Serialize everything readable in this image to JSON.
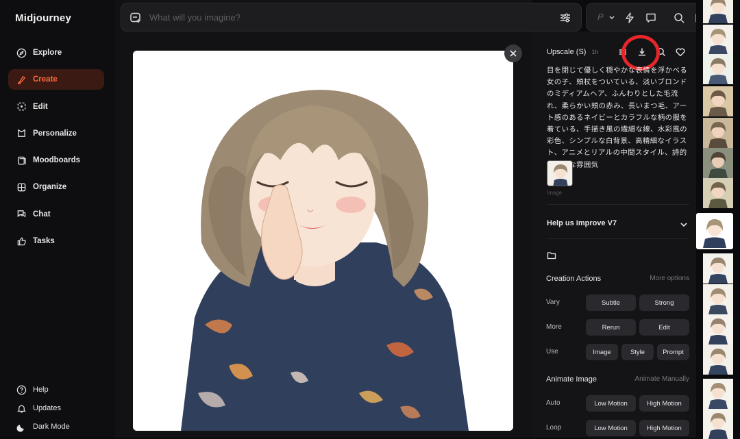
{
  "app": {
    "title": "Midjourney"
  },
  "nav": {
    "items": [
      {
        "label": "Explore",
        "icon": "compass-icon"
      },
      {
        "label": "Create",
        "icon": "brush-icon",
        "active": true
      },
      {
        "label": "Edit",
        "icon": "edit-icon"
      },
      {
        "label": "Personalize",
        "icon": "personalize-icon"
      },
      {
        "label": "Moodboards",
        "icon": "moodboard-icon"
      },
      {
        "label": "Organize",
        "icon": "grid-icon"
      },
      {
        "label": "Chat",
        "icon": "chat-icon"
      },
      {
        "label": "Tasks",
        "icon": "thumbs-up-icon"
      }
    ],
    "bottom": [
      {
        "label": "Help",
        "icon": "help-icon"
      },
      {
        "label": "Updates",
        "icon": "bell-icon"
      },
      {
        "label": "Dark Mode",
        "icon": "moon-icon"
      }
    ]
  },
  "search": {
    "placeholder": "What will you imagine?"
  },
  "toolbox": {
    "p_label": "P"
  },
  "panel": {
    "upscale_label": "Upscale (S)",
    "time_ago": "1h",
    "prompt": "目を閉じて優しく穏やかな表情を浮かべる女の子、頬杖をついている、淡いブロンドのミディアムヘア、ふんわりとした毛流れ、柔らかい頬の赤み、長いまつ毛、アート感のあるネイビーとカラフルな柄の服を着ている、手描き風の繊細な線、水彩風の彩色、シンプルな白背景、高精細なイラスト、アニメとリアルの中間スタイル、詩的で静かな雰囲気",
    "ref_caption": "Image",
    "help_title": "Help us improve V7",
    "creation": {
      "title": "Creation Actions",
      "link": "More options"
    },
    "vary": {
      "label": "Vary",
      "buttons": [
        "Subtle",
        "Strong"
      ]
    },
    "more": {
      "label": "More",
      "buttons": [
        "Rerun",
        "Edit"
      ]
    },
    "use": {
      "label": "Use",
      "buttons": [
        "Image",
        "Style",
        "Prompt"
      ]
    },
    "animate": {
      "title": "Animate Image",
      "link": "Animate Manually"
    },
    "auto": {
      "label": "Auto",
      "buttons": [
        "Low Motion",
        "High Motion"
      ]
    },
    "loop": {
      "label": "Loop",
      "buttons": [
        "Low Motion",
        "High Motion"
      ]
    }
  },
  "colors": {
    "accent": "#ff6a3d",
    "active_bg": "#3a1a12",
    "highlight_ring": "#e6262b"
  }
}
